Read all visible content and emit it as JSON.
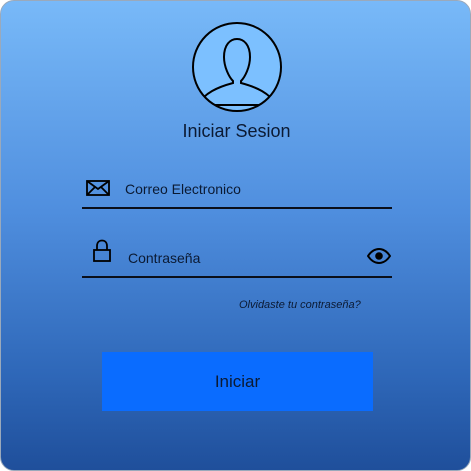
{
  "login": {
    "title": "Iniciar Sesion",
    "email_placeholder": "Correo Electronico",
    "password_placeholder": "Contraseña",
    "forgot_password": "Olvidaste tu contraseña?",
    "submit_label": "Iniciar"
  },
  "icons": {
    "avatar": "user-avatar-icon",
    "email": "envelope-icon",
    "password": "padlock-icon",
    "show_password": "eye-icon"
  },
  "colors": {
    "gradient_top": "#78b9f8",
    "gradient_bottom": "#1f4f9b",
    "button": "#0a6cff",
    "text": "#0b1a33"
  }
}
